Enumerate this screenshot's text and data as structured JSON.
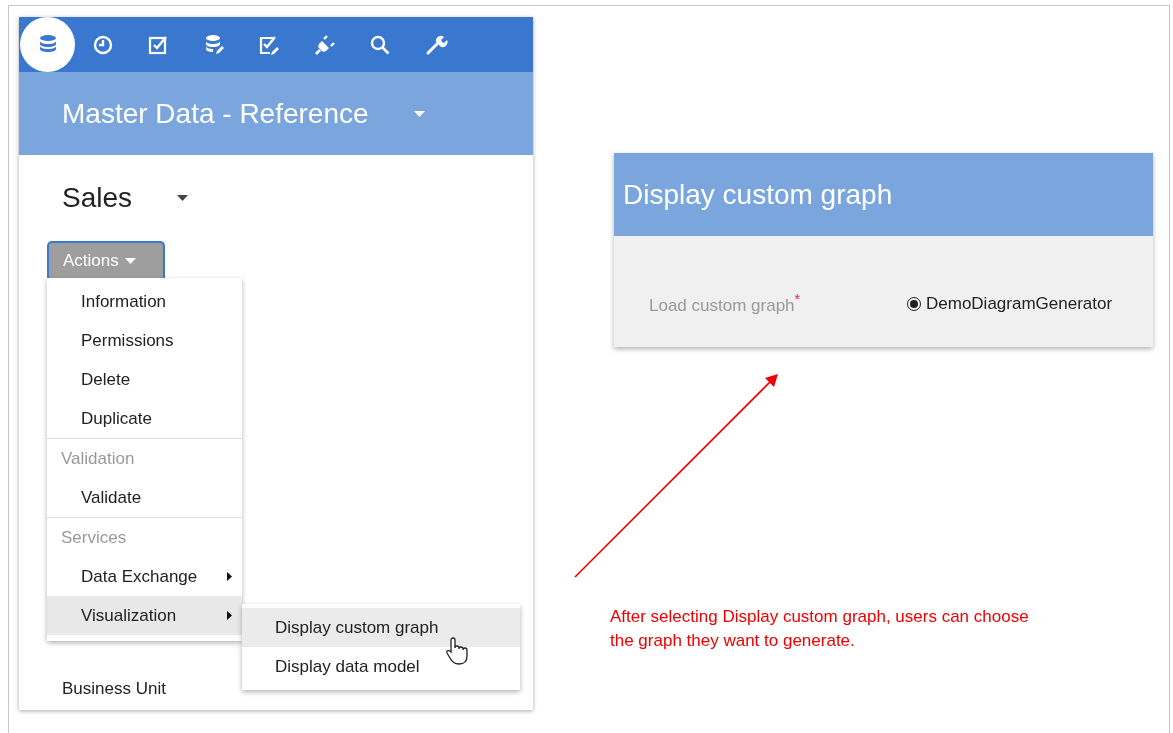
{
  "toolbar": [
    {
      "selected": true
    },
    {
      "selected": false
    },
    {
      "selected": false
    },
    {
      "selected": false
    },
    {
      "selected": false
    },
    {
      "selected": false
    },
    {
      "selected": false
    },
    {
      "selected": false
    }
  ],
  "header": {
    "title": "Master Data - Reference"
  },
  "section": {
    "title": "Sales"
  },
  "actions_button": "Actions",
  "list": [
    "Business Unit"
  ],
  "menu": [
    {
      "kind": "item",
      "label": "Information",
      "submenu": false,
      "selected": false
    },
    {
      "kind": "item",
      "label": "Permissions",
      "submenu": false,
      "selected": false
    },
    {
      "kind": "item",
      "label": "Delete",
      "submenu": false,
      "selected": false
    },
    {
      "kind": "item",
      "label": "Duplicate",
      "submenu": false,
      "selected": false
    },
    {
      "kind": "header",
      "label": "Validation"
    },
    {
      "kind": "item",
      "label": "Validate",
      "submenu": false,
      "selected": false
    },
    {
      "kind": "header",
      "label": "Services"
    },
    {
      "kind": "item",
      "label": "Data Exchange",
      "submenu": true,
      "selected": false
    },
    {
      "kind": "item",
      "label": "Visualization",
      "submenu": true,
      "selected": true
    }
  ],
  "submenu": [
    {
      "label": "Display custom graph",
      "selected": true
    },
    {
      "label": "Display data model",
      "selected": false
    }
  ],
  "dialog": {
    "title": "Display custom graph",
    "field_label": "Load custom graph",
    "required_mark": "*",
    "option": {
      "label": "DemoDiagramGenerator",
      "selected": true
    }
  },
  "annotation": "After selecting Display custom graph, users can choose the graph they want to generate."
}
